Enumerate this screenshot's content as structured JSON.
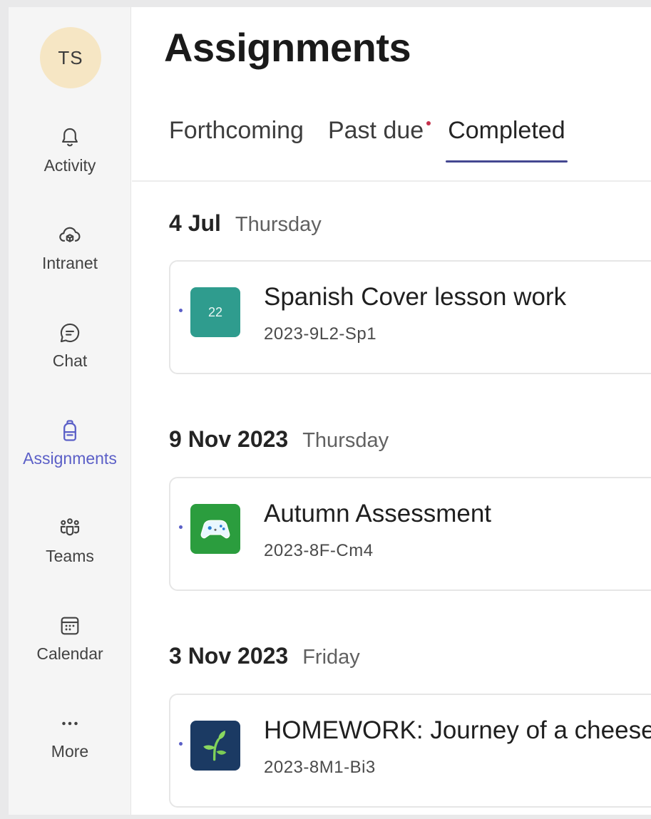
{
  "user": {
    "initials": "TS"
  },
  "sidebar": {
    "items": [
      {
        "label": "Activity",
        "icon": "bell-icon"
      },
      {
        "label": "Intranet",
        "icon": "cloud-icon"
      },
      {
        "label": "Chat",
        "icon": "chat-icon"
      },
      {
        "label": "Assignments",
        "icon": "backpack-icon",
        "active": true
      },
      {
        "label": "Teams",
        "icon": "teams-icon"
      },
      {
        "label": "Calendar",
        "icon": "calendar-icon"
      },
      {
        "label": "More",
        "icon": "more-icon"
      }
    ]
  },
  "header": {
    "title": "Assignments"
  },
  "tabs": [
    {
      "label": "Forthcoming"
    },
    {
      "label": "Past due",
      "has_dot": true
    },
    {
      "label": "Completed",
      "active": true
    }
  ],
  "groups": [
    {
      "date": "4 Jul",
      "day": "Thursday",
      "assignment": {
        "title": "Spanish Cover lesson work",
        "code": "2023-9L2-Sp1",
        "icon": "calendar-22-icon",
        "icon_text": "22",
        "icon_color": "#2f9c8e"
      }
    },
    {
      "date": "9 Nov 2023",
      "day": "Thursday",
      "assignment": {
        "title": "Autumn Assessment",
        "code": "2023-8F-Cm4",
        "icon": "game-controller-icon",
        "icon_color": "#2b9d3e"
      }
    },
    {
      "date": "3 Nov 2023",
      "day": "Friday",
      "assignment": {
        "title": "HOMEWORK: Journey of a cheese",
        "code": "2023-8M1-Bi3",
        "icon": "sprout-icon",
        "icon_color": "#1b3a63"
      }
    }
  ],
  "colors": {
    "accent": "#5b5fc7",
    "tab_underline": "#444791",
    "badge_dot": "#c4314b",
    "sidebar_bg": "#f5f5f5"
  }
}
